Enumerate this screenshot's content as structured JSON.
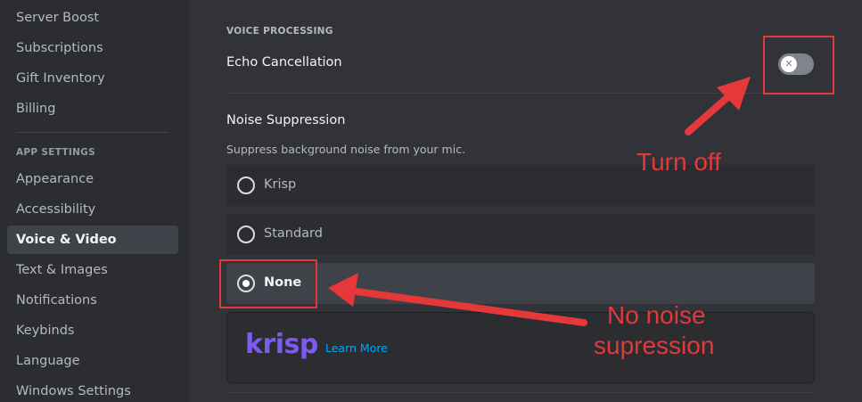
{
  "sidebar": {
    "items_top": [
      "Server Boost",
      "Subscriptions",
      "Gift Inventory",
      "Billing"
    ],
    "app_settings_header": "APP SETTINGS",
    "items_app": [
      "Appearance",
      "Accessibility",
      "Voice & Video",
      "Text & Images",
      "Notifications",
      "Keybinds",
      "Language",
      "Windows Settings"
    ],
    "active_item": "Voice & Video"
  },
  "voice_processing": {
    "header": "VOICE PROCESSING",
    "echo_cancellation": {
      "label": "Echo Cancellation",
      "enabled": false,
      "toggle_icon": "close-icon"
    },
    "noise_suppression": {
      "title": "Noise Suppression",
      "description": "Suppress background noise from your mic.",
      "options": [
        "Krisp",
        "Standard",
        "None"
      ],
      "selected": "None"
    },
    "krisp_card": {
      "logo": "krisp",
      "link": "Learn More"
    }
  },
  "annotations": {
    "toggle_note": "Turn off",
    "none_note_line1": "No noise",
    "none_note_line2": "supression"
  },
  "colors": {
    "background": "#313338",
    "sidebar": "#2b2d31",
    "annotation": "#e5383b",
    "krisp": "#7e5bf0",
    "link": "#00a8fc"
  }
}
